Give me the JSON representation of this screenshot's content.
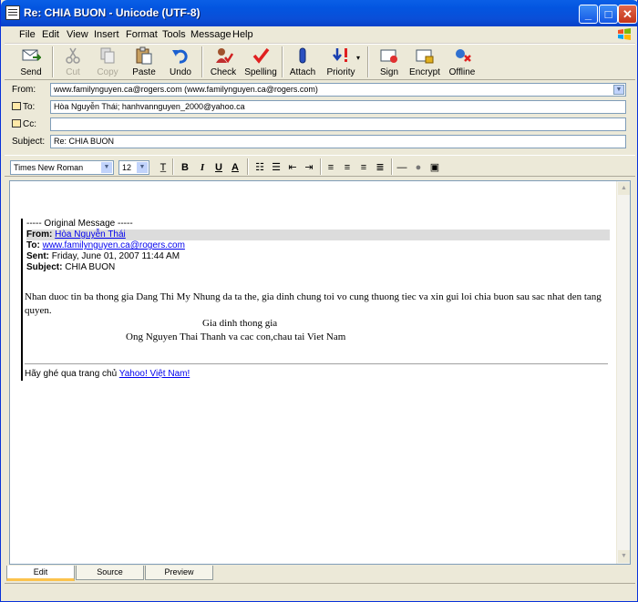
{
  "window": {
    "title": "Re: CHIA BUON - Unicode (UTF-8)"
  },
  "menu": [
    "File",
    "Edit",
    "View",
    "Insert",
    "Format",
    "Tools",
    "Message",
    "Help"
  ],
  "toolbar": [
    {
      "label": "Send",
      "icon": "send-icon",
      "enabled": true
    },
    {
      "label": "Cut",
      "icon": "cut-icon",
      "enabled": false
    },
    {
      "label": "Copy",
      "icon": "copy-icon",
      "enabled": false
    },
    {
      "label": "Paste",
      "icon": "paste-icon",
      "enabled": true
    },
    {
      "label": "Undo",
      "icon": "undo-icon",
      "enabled": true
    },
    {
      "label": "Check",
      "icon": "check-icon",
      "enabled": true
    },
    {
      "label": "Spelling",
      "icon": "spelling-icon",
      "enabled": true
    },
    {
      "label": "Attach",
      "icon": "attach-icon",
      "enabled": true
    },
    {
      "label": "Priority",
      "icon": "priority-icon",
      "enabled": true
    },
    {
      "label": "Sign",
      "icon": "sign-icon",
      "enabled": true
    },
    {
      "label": "Encrypt",
      "icon": "encrypt-icon",
      "enabled": true
    },
    {
      "label": "Offline",
      "icon": "offline-icon",
      "enabled": true
    }
  ],
  "headers": {
    "from_label": "From:",
    "from_value": "www.familynguyen.ca@rogers.com   (www.familynguyen.ca@rogers.com)",
    "to_label": "To:",
    "to_value": "Hòa Nguyễn Thái; hanhvannguyen_2000@yahoo.ca",
    "cc_label": "Cc:",
    "cc_value": "",
    "subject_label": "Subject:",
    "subject_value": "Re: CHIA BUON"
  },
  "format": {
    "font": "Times New Roman",
    "size": "12"
  },
  "message": {
    "original_header": "----- Original Message -----",
    "from_label": "From:",
    "from_value": "Hòa Nguyễn Thái",
    "to_label": "To:",
    "to_value": "www.familynguyen.ca@rogers.com",
    "sent_label": "Sent:",
    "sent_value": "Friday, June 01, 2007 11:44 AM",
    "subject_label": "Subject:",
    "subject_value": "CHIA BUON",
    "body": "Nhan duoc tin ba thong gia Dang Thi My Nhung da ta the, gia dinh chung toi vo cung thuong tiec va xin gui loi chia buon sau sac nhat den tang quyen.",
    "sig_line1": "Gia dinh thong gia",
    "sig_line2": "Ong Nguyen Thai Thanh va cac con,chau tai Viet Nam",
    "footer_text": "Hãy ghé qua trang chủ ",
    "footer_link": "Yahoo! Việt Nam!"
  },
  "tabs": [
    "Edit",
    "Source",
    "Preview"
  ],
  "active_tab": "Edit"
}
